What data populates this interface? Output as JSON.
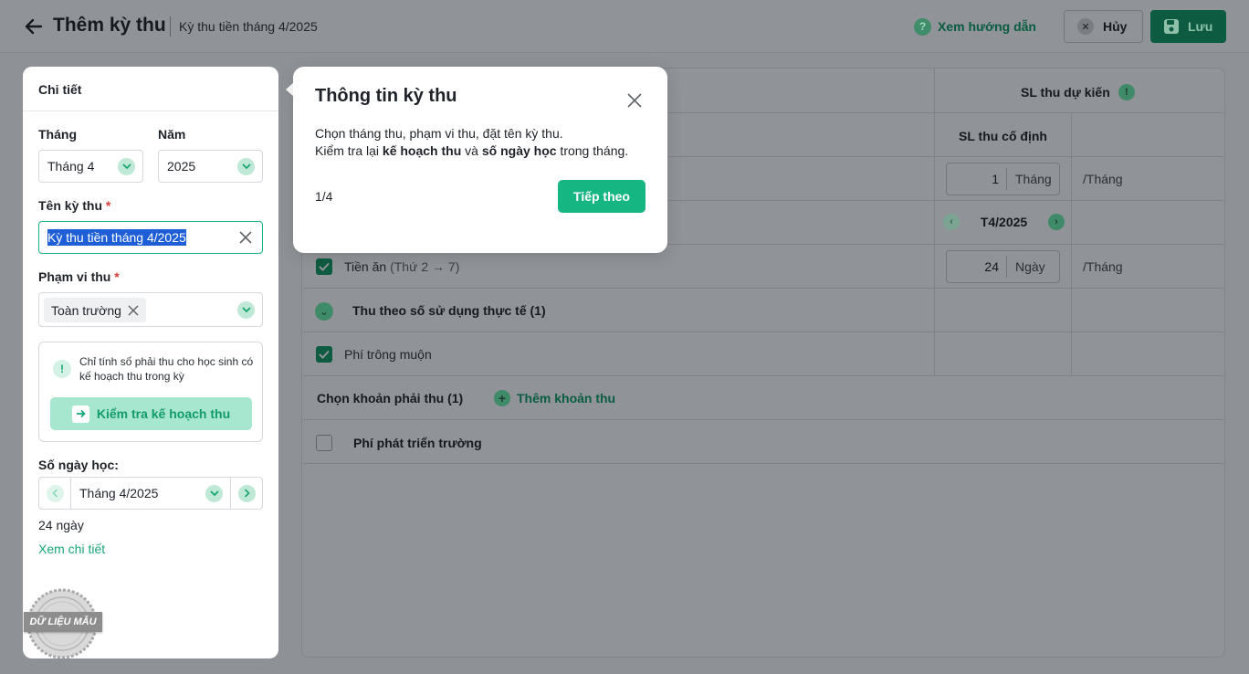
{
  "header": {
    "title": "Thêm kỳ thu",
    "subtitle": "Kỳ thu tiền tháng 4/2025",
    "guide_label": "Xem hướng dẫn",
    "cancel_label": "Hủy",
    "save_label": "Lưu"
  },
  "left_panel": {
    "title": "Chi tiết",
    "month_label": "Tháng",
    "month_value": "Tháng 4",
    "year_label": "Năm",
    "year_value": "2025",
    "name_label": "Tên kỳ thu",
    "name_value": "Kỳ thu tiền tháng 4/2025",
    "scope_label": "Phạm vi thu",
    "scope_tag": "Toàn trường",
    "required_mark": "*",
    "info_text": "Chỉ tính số phải thu cho học sinh có kế hoạch thu trong kỳ",
    "check_plan_label": "Kiểm tra kế hoạch thu",
    "days_label": "Số ngày học:",
    "days_month_value": "Tháng 4/2025",
    "days_count": "24 ngày",
    "detail_link": "Xem chi tiết",
    "stamp_label": "DỮ LIỆU MẪU"
  },
  "table": {
    "col_expected": "SL thu dự kiến",
    "col_fixed": "SL thu cố định",
    "row1": {
      "value": "1",
      "unit": "Tháng",
      "per": "/Tháng"
    },
    "month_nav": "T4/2025",
    "row_food": {
      "name": "Tiền ăn",
      "note": "(Thứ 2 → 7)",
      "value": "24",
      "unit": "Ngày",
      "per": "/Tháng"
    },
    "group_actual": "Thu theo số sử dụng thực tế (1)",
    "row_late": "Phí trông muộn",
    "choose_label": "Chọn khoản phải thu (1)",
    "add_label": "Thêm khoản thu",
    "row_dev": "Phí phát triển trường"
  },
  "popover": {
    "title": "Thông tin kỳ thu",
    "line1": "Chọn tháng thu, phạm vi thu, đặt tên kỳ thu.",
    "line2_a": "Kiểm tra lại ",
    "line2_b": "kế hoạch thu",
    "line2_c": " và ",
    "line2_d": "số ngày học",
    "line2_e": " trong tháng.",
    "step": "1/4",
    "next_label": "Tiếp theo"
  },
  "colors": {
    "accent": "#16b683",
    "overlay": "#909397"
  }
}
